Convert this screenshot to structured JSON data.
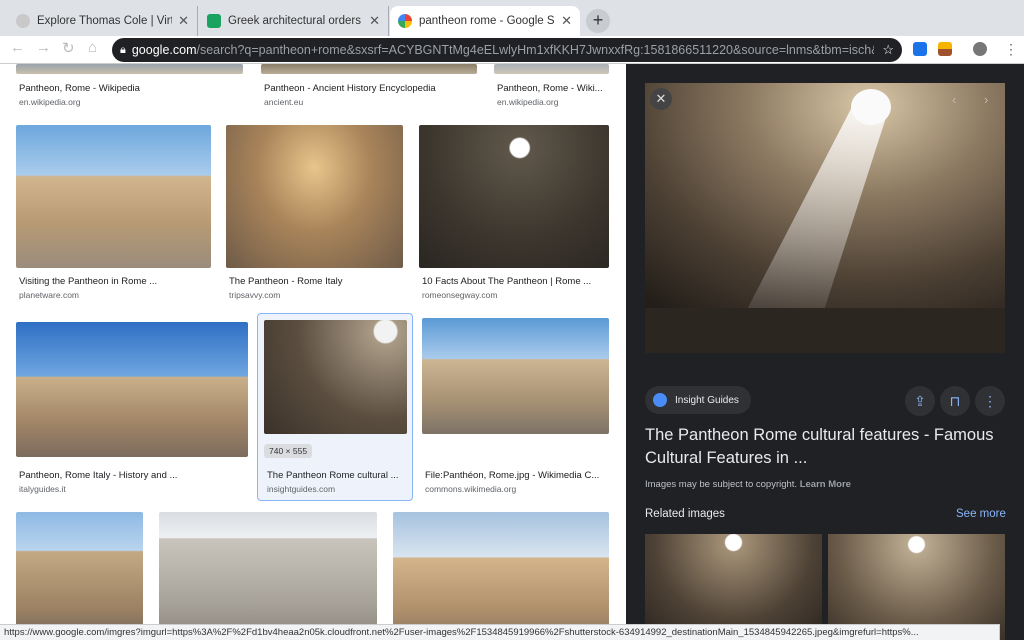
{
  "tabs": [
    {
      "title": "Explore Thomas Cole | Virtual C",
      "active": false
    },
    {
      "title": "Greek architectural orders (art",
      "active": false
    },
    {
      "title": "pantheon rome - Google Searc",
      "active": true
    }
  ],
  "address": {
    "domain": "google.com",
    "path": "/search?q=pantheon+rome&sxsrf=ACYBGNTtMg4eELwlyHm1xfKKH7JwnxxfRg:1581866511220&source=lnms&tbm=isch&sa..."
  },
  "results": [
    {
      "caption": "Pantheon, Rome - Wikipedia",
      "source": "en.wikipedia.org"
    },
    {
      "caption": "Pantheon - Ancient History Encyclopedia",
      "source": "ancient.eu"
    },
    {
      "caption": "Pantheon, Rome - Wiki...",
      "source": "en.wikipedia.org"
    },
    {
      "caption": "Visiting the Pantheon in Rome ...",
      "source": "planetware.com"
    },
    {
      "caption": "The Pantheon - Rome Italy",
      "source": "tripsavvy.com"
    },
    {
      "caption": "10 Facts About The Pantheon | Rome ...",
      "source": "romeonsegway.com"
    },
    {
      "caption": "Pantheon, Rome Italy - History and ...",
      "source": "italyguides.it"
    },
    {
      "caption": "The Pantheon Rome cultural ...",
      "source": "insightguides.com"
    },
    {
      "caption": "File:Panthéon, Rome.jpg - Wikimedia C...",
      "source": "commons.wikimedia.org"
    }
  ],
  "selected_dims": "740 × 555",
  "panel": {
    "source_chip": "Insight Guides",
    "title": "The Pantheon Rome cultural features - Famous Cultural Features in ...",
    "copyright": "Images may be subject to copyright.",
    "learn_more": "Learn More",
    "related_label": "Related images",
    "see_more": "See more"
  },
  "status_url": "https://www.google.com/imgres?imgurl=https%3A%2F%2Fd1bv4heaa2n05k.cloudfront.net%2Fuser-images%2F1534845919966%2Fshutterstock-634914992_destinationMain_1534845942265.jpeg&imgrefurl=https%..."
}
